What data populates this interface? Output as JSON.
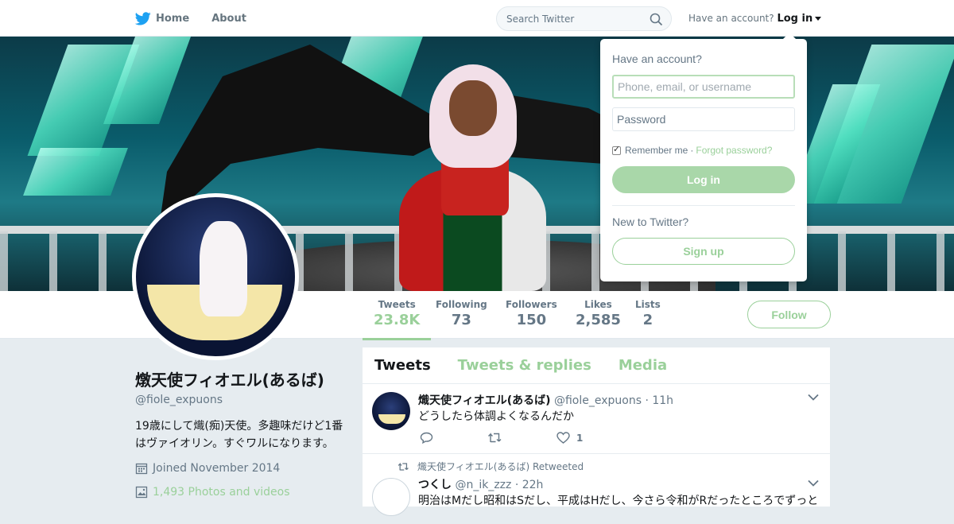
{
  "nav": {
    "home_label": "Home",
    "about_label": "About",
    "search_placeholder": "Search Twitter",
    "have_account_text": "Have an account?",
    "login_label": "Log in"
  },
  "profile": {
    "display_name": "燉天使フィオエル(あるば)",
    "handle": "@fiole_expuons",
    "bio": "19歳にして熾(痴)天使。多趣味だけど1番はヴァイオリン。すぐワルになります。",
    "joined": "Joined November 2014",
    "photos": "1,493 Photos and videos"
  },
  "stats": [
    {
      "label": "Tweets",
      "value": "23.8K"
    },
    {
      "label": "Following",
      "value": "73"
    },
    {
      "label": "Followers",
      "value": "150"
    },
    {
      "label": "Likes",
      "value": "2,585"
    },
    {
      "label": "Lists",
      "value": "2"
    }
  ],
  "follow_label": "Follow",
  "timeline": {
    "tabs": [
      "Tweets",
      "Tweets & replies",
      "Media"
    ],
    "tweets": [
      {
        "name": "熾天使フィオエル(あるば)",
        "handle": "@fiole_expuons",
        "time": "· 11h",
        "text": "どうしたら体調よくなるんだか",
        "likes": "1"
      },
      {
        "retweeted_by": "熾天使フィオエル(あるば) Retweeted",
        "name": "つくし",
        "handle": "@n_ik_zzz",
        "time": "· 22h",
        "text": "明治はMだし昭和はSだし、平成はHだし、今さら令和がRだったところでずっと"
      }
    ]
  },
  "login_dropdown": {
    "title": "Have an account?",
    "username_placeholder": "Phone, email, or username",
    "password_placeholder": "Password",
    "remember_label": "Remember me",
    "separator": "·",
    "forgot_label": "Forgot password?",
    "login_button": "Log in",
    "new_text": "New to Twitter?",
    "signup_button": "Sign up"
  },
  "colors": {
    "accent": "#9ad09a",
    "twitter_blue": "#1da1f2",
    "text": "#14171a",
    "muted": "#657786"
  }
}
